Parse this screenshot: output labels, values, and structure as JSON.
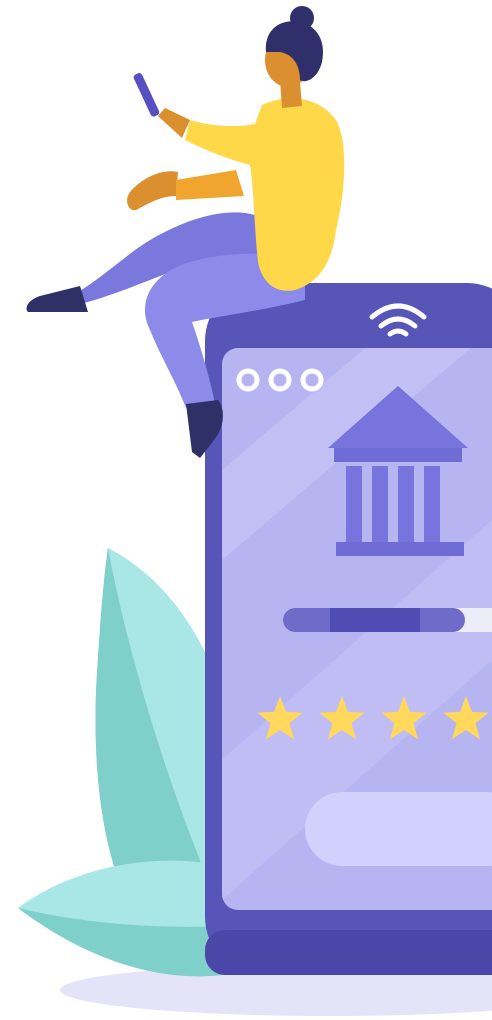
{
  "illustration": {
    "rating": {
      "stars_visible": 4,
      "star_color": "#FFD85C"
    },
    "progress": {
      "fraction": 0.86
    },
    "colors": {
      "phone_frame": "#5855B9",
      "phone_frame_dark": "#4A47A8",
      "screen": "#B7B4F2",
      "screen_light": "#C9C6FA",
      "bank_icon": "#7774DE",
      "progress_track": "#6F6CC9",
      "progress_fill": "#4F4CB3",
      "progress_remaining": "#EDEDF7",
      "button": "#D2D0FC",
      "leaf_light": "#A8E7E6",
      "leaf_dark": "#7FCFCB",
      "shadow": "#E4E3F7",
      "person_shirt": "#FFD84A",
      "person_pants": "#8D8BEA",
      "person_skin": "#DB8F2E",
      "person_hair": "#2E2F6B",
      "person_shoes": "#2E3066",
      "person_phone": "#5650C0"
    },
    "icons": [
      "wifi-icon",
      "window-dots-icon",
      "bank-icon",
      "star-icon"
    ]
  }
}
